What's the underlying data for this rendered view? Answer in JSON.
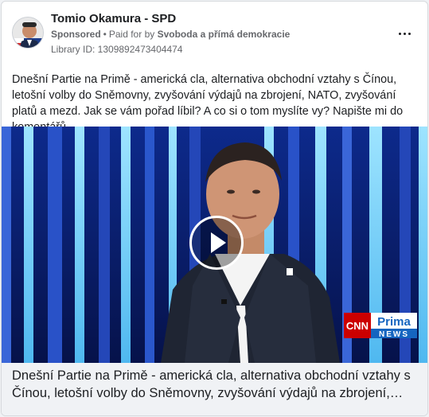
{
  "ad": {
    "page_name": "Tomio Okamura - SPD",
    "sponsored_label": "Sponsored",
    "separator": "•",
    "paid_for_prefix": "Paid for by",
    "payer": "Svoboda a přímá demokracie",
    "library_id": "Library ID: 1309892473404474",
    "body_text": "Dnešní Partie na Primě - americká cla, alternativa obchodní vztahy s Čínou, letošní volby do Sněmovny, zvyšování výdajů na zbrojení, NATO, zvyšování platů a mezd. Jak se vám pořad líbil? A co si o tom myslíte vy? Napište mi do komentářů.",
    "caption_text": "Dnešní Partie na Primě - americká cla, alternativa obchodní vztahy s Čínou, letošní volby do Sněmovny, zvyšování výdajů na zbrojení,…"
  },
  "video": {
    "logo_cnn": "CNN",
    "logo_prima": "Prima",
    "logo_news": "NEWS"
  },
  "icons": {
    "more": "more-options-icon",
    "play": "play-icon"
  },
  "colors": {
    "background": "#ffffff",
    "studio_blue": "#0a1c6b",
    "studio_light": "#7fd3ff",
    "cnn_red": "#cc0000",
    "prima_blue": "#1565c0"
  }
}
